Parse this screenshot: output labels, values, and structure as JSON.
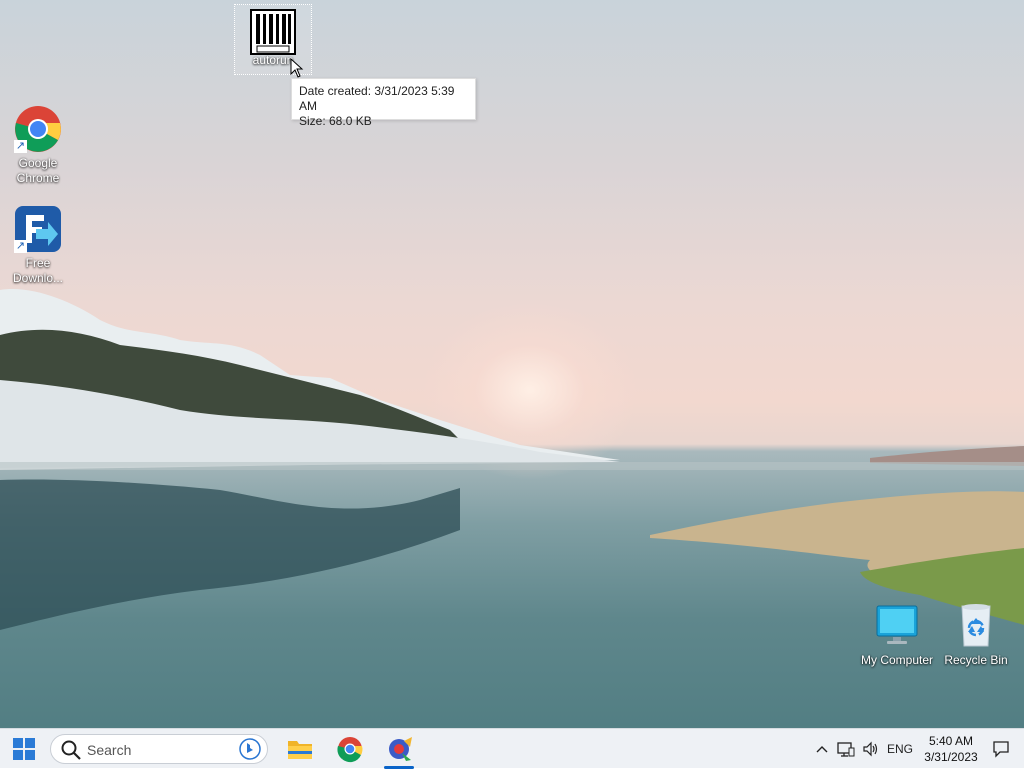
{
  "desktop": {
    "icons": [
      {
        "label": "autorun",
        "icon": "barcode-file-icon",
        "selected": true
      },
      {
        "label_line1": "Google",
        "label_line2": "Chrome",
        "icon": "chrome-icon"
      },
      {
        "label_line1": "Free",
        "label_line2": "Downlo...",
        "icon": "free-download-manager-icon"
      },
      {
        "label": "My Computer",
        "icon": "monitor-icon"
      },
      {
        "label": "Recycle Bin",
        "icon": "recycle-bin-icon"
      }
    ],
    "tooltip": {
      "line1": "Date created: 3/31/2023 5:39 AM",
      "line2": "Size: 68.0 KB"
    }
  },
  "taskbar": {
    "search_placeholder": "Search",
    "apps": [
      "start-icon",
      "file-explorer-icon",
      "chrome-icon",
      "app-icon"
    ],
    "tray": {
      "language": "ENG",
      "time": "5:40 AM",
      "date": "3/31/2023"
    }
  },
  "colors": {
    "accent": "#0a64c8",
    "taskbar": "#eef1f5"
  }
}
